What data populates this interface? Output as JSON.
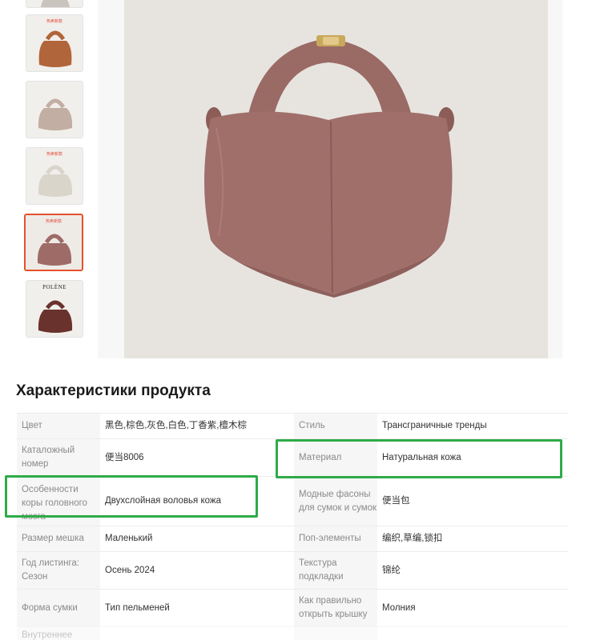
{
  "thumbnails": [
    {
      "name": "thumb-partial",
      "color": "#c9c4be",
      "label": ""
    },
    {
      "name": "thumb-brown",
      "color": "#b0653a",
      "label": "热卖新款"
    },
    {
      "name": "thumb-taupe",
      "color": "#c2aea2",
      "label": ""
    },
    {
      "name": "thumb-cream",
      "color": "#dad5cb",
      "label": "热卖新款"
    },
    {
      "name": "thumb-mauve",
      "color": "#9e6b66",
      "label": "热卖新款",
      "selected": true
    },
    {
      "name": "thumb-burgundy",
      "color": "#6a322c",
      "label": "POLÈNE"
    }
  ],
  "main_image": {
    "bag_color": "#9f6f6a",
    "background": "#e7e4e0",
    "clasp_color": "#c8a85a"
  },
  "section_title": "Характеристики продукта",
  "specs": [
    {
      "l1": "Цвет",
      "v1": "黑色,棕色,灰色,白色,丁香紫,檀木棕",
      "l2": "Стиль",
      "v2": "Трансграничные тренды"
    },
    {
      "l1": "Каталожный номер",
      "v1": "便当8006",
      "l2": "Материал",
      "v2": "Натуральная кожа"
    },
    {
      "l1": "Особенности коры головного мозга",
      "v1": "Двухслойная воловья кожа",
      "l2": "Модные фасоны для сумок и сумок",
      "v2": "便当包"
    },
    {
      "l1": "Размер мешка",
      "v1": "Маленький",
      "l2": "Поп-элементы",
      "v2": "编织,草编,锁扣"
    },
    {
      "l1": "Год листинга: Сезон",
      "v1": "Осень 2024",
      "l2": "Текстура подкладки",
      "v2": "锦纶"
    },
    {
      "l1": "Форма сумки",
      "v1": "Тип пельменей",
      "l2": "Как правильно открыть крышку",
      "v2": "Молния"
    },
    {
      "l1": "Внутреннее",
      "v1": "",
      "l2": "",
      "v2": ""
    }
  ],
  "highlight_color": "#2eab48"
}
